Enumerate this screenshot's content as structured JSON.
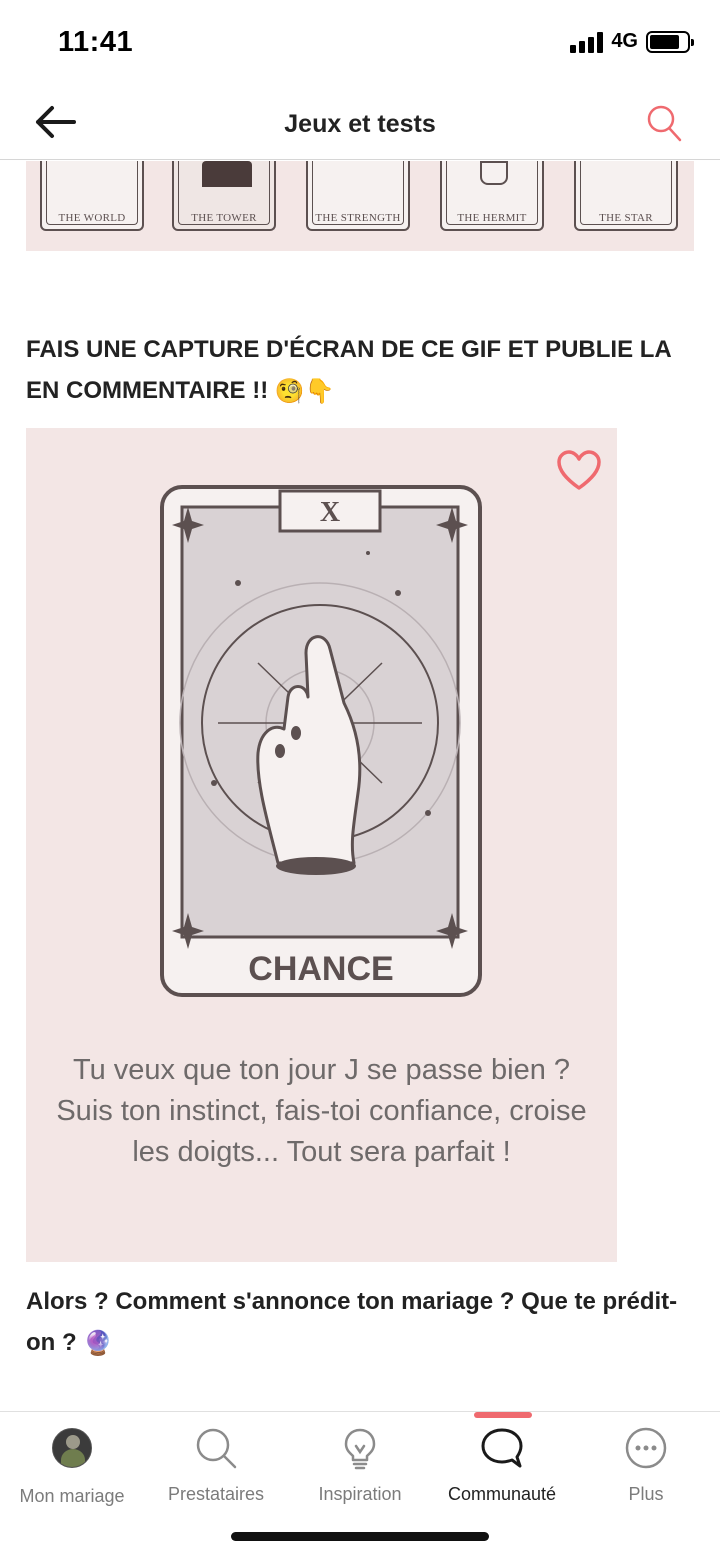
{
  "status_bar": {
    "time": "11:41",
    "network": "4G"
  },
  "header": {
    "title": "Jeux et tests",
    "back_icon": "arrow-left-icon",
    "search_icon": "search-icon"
  },
  "tarot_strip": {
    "cards": [
      "THE WORLD",
      "THE TOWER",
      "THE STRENGTH",
      "THE HERMIT",
      "THE STAR"
    ]
  },
  "post": {
    "headline": "FAIS UNE CAPTURE D'ÉCRAN DE CE GIF ET PUBLIE LA EN COMMENTAIRE !!",
    "headline_emojis": "🧐👇",
    "card": {
      "number": "X",
      "name": "CHANCE",
      "caption": "Tu veux que ton jour J se passe bien ? Suis ton instinct, fais-toi confiance, croise les doigts... Tout sera parfait !"
    },
    "question": "Alors ? Comment s'annonce ton mariage ? Que te prédit-on ?",
    "question_emoji": "🔮"
  },
  "colors": {
    "accent": "#ef6a6f",
    "card_bg": "#f3e6e5",
    "card_ink": "#5c5050"
  },
  "bottom_nav": {
    "items": [
      {
        "label": "Mon mariage",
        "icon": "avatar"
      },
      {
        "label": "Prestataires",
        "icon": "search-icon"
      },
      {
        "label": "Inspiration",
        "icon": "lightbulb-icon"
      },
      {
        "label": "Communauté",
        "icon": "chat-bubble-icon",
        "active": true
      },
      {
        "label": "Plus",
        "icon": "more-dots-icon"
      }
    ]
  }
}
